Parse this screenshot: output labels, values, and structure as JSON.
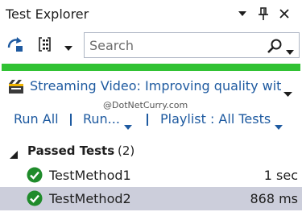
{
  "window": {
    "title": "Test Explorer",
    "dropdown_icon": "chevron-down-icon",
    "pin_icon": "pin-icon",
    "close_icon": "close-icon"
  },
  "toolbar": {
    "run_icon": "run-tests-icon",
    "group_by_icon": "group-by-icon",
    "search": {
      "placeholder": "Search",
      "value": ""
    }
  },
  "progress": {
    "fraction": 1.0,
    "color": "#31c234"
  },
  "playlist": {
    "label": "Streaming Video: Improving quality wit",
    "icon": "playlist-icon"
  },
  "watermark": "@DotNetCurry.com",
  "commands": {
    "run_all": "Run All",
    "run": "Run...",
    "playlist": "Playlist : All Tests"
  },
  "group": {
    "label": "Passed Tests",
    "count": "(2)"
  },
  "tests": [
    {
      "name": "TestMethod1",
      "duration": "1 sec",
      "status": "passed",
      "selected": false
    },
    {
      "name": "TestMethod2",
      "duration": "868 ms",
      "status": "passed",
      "selected": true
    }
  ],
  "colors": {
    "link": "#1e5aa0",
    "pass": "#1f8b2b",
    "selection": "#cccedb"
  }
}
